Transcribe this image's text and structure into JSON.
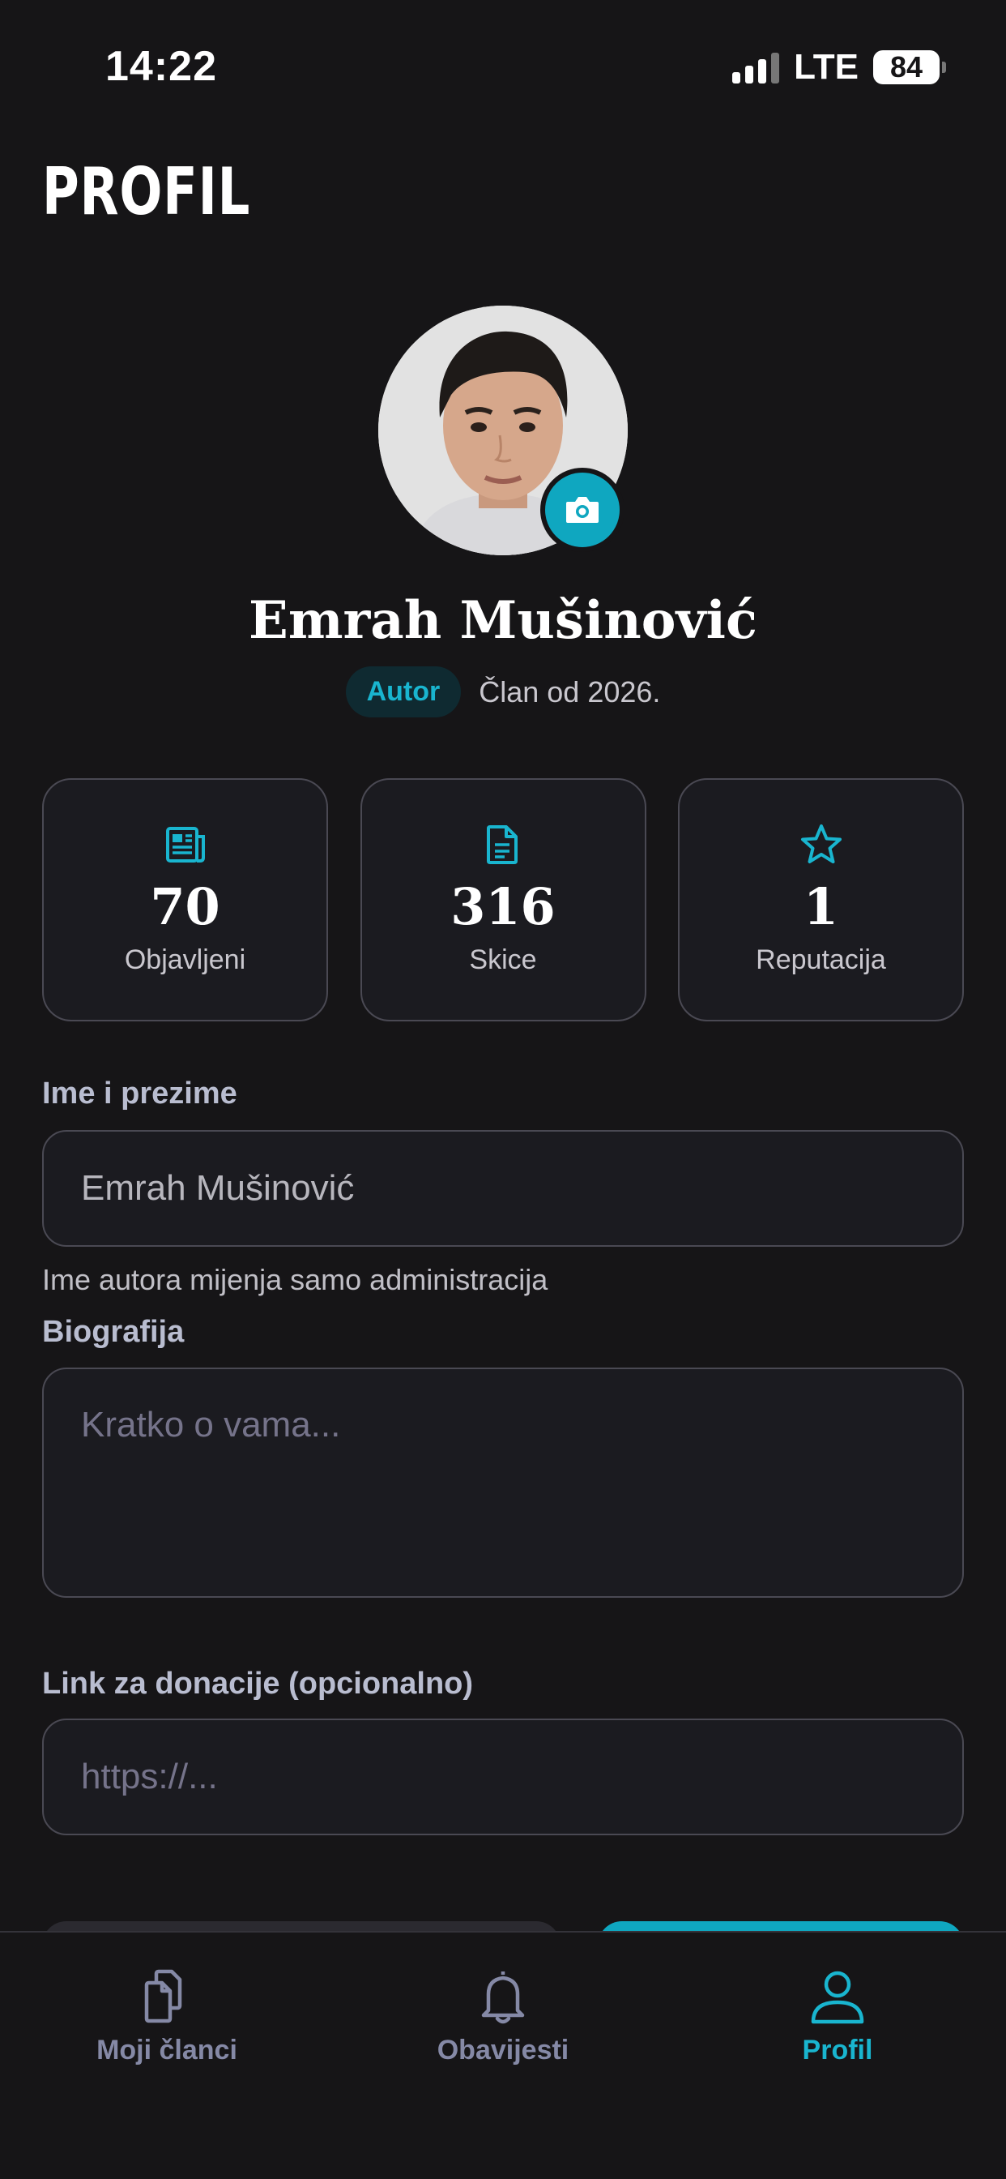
{
  "status_bar": {
    "time": "14:22",
    "network": "LTE",
    "battery": "84"
  },
  "page": {
    "title": "PROFIL"
  },
  "profile": {
    "name": "Emrah Mušinović",
    "role": "Autor",
    "member_since": "Član od 2026."
  },
  "stats": [
    {
      "icon": "newspaper-icon",
      "value": "70",
      "label": "Objavljeni"
    },
    {
      "icon": "document-icon",
      "value": "316",
      "label": "Skice"
    },
    {
      "icon": "star-icon",
      "value": "1",
      "label": "Reputacija"
    }
  ],
  "form": {
    "name": {
      "label": "Ime i prezime",
      "value": "Emrah Mušinović",
      "hint": "Ime autora mijenja samo administracija"
    },
    "bio": {
      "label": "Biografija",
      "placeholder": "Kratko o vama..."
    },
    "donation": {
      "label": "Link za donacije (opcionalno)",
      "placeholder": "https://..."
    }
  },
  "nav": [
    {
      "icon": "documents-icon",
      "label": "Moji članci",
      "active": false
    },
    {
      "icon": "bell-icon",
      "label": "Obavijesti",
      "active": false
    },
    {
      "icon": "user-icon",
      "label": "Profil",
      "active": true
    }
  ],
  "colors": {
    "accent": "#0fa7c0",
    "background": "#161517",
    "card_border": "#4a4953",
    "nav_inactive": "#8589a6"
  }
}
